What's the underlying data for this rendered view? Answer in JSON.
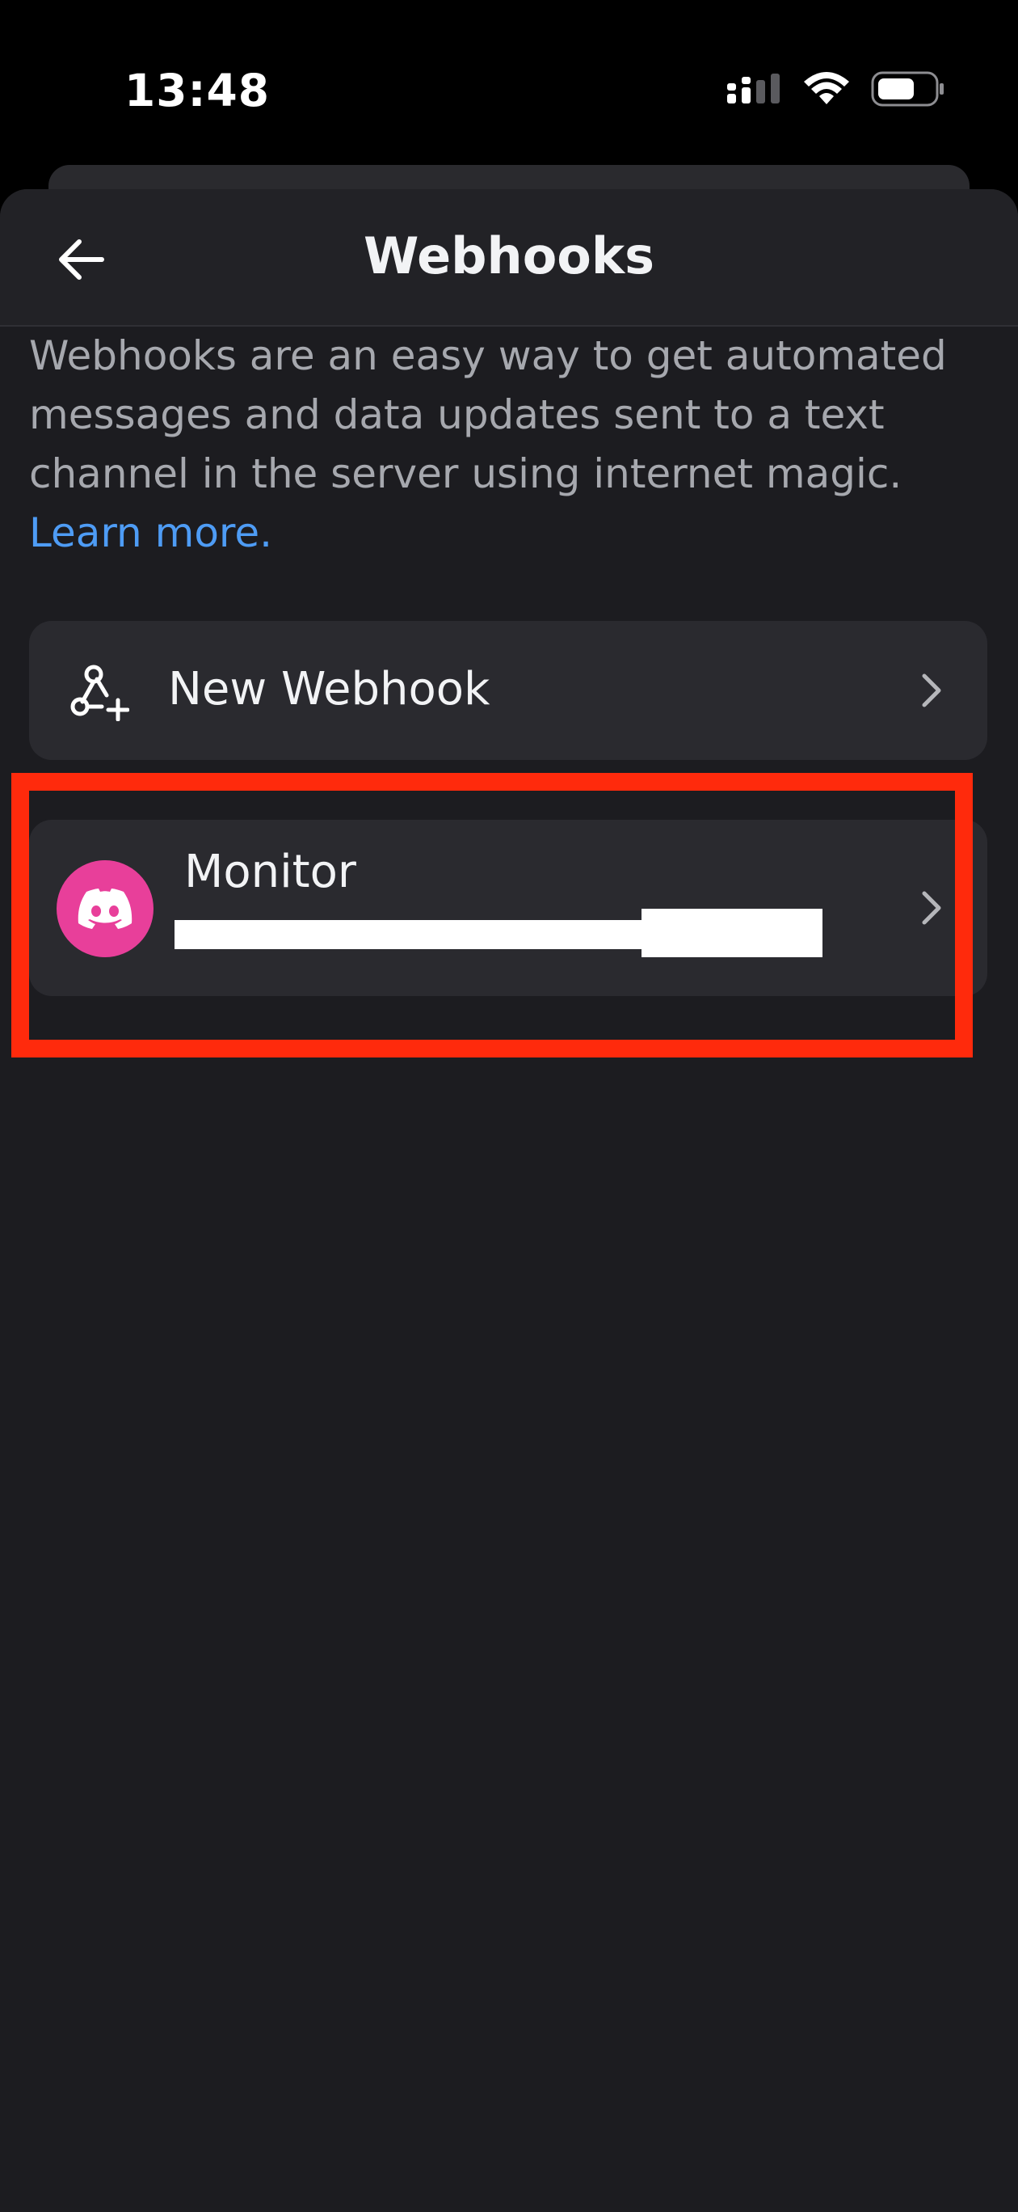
{
  "status_bar": {
    "time": "13:48",
    "icons": [
      "cellular-signal-icon",
      "wifi-icon",
      "battery-icon"
    ]
  },
  "header": {
    "title": "Webhooks",
    "back_icon": "arrow-left-icon"
  },
  "description": {
    "text": "Webhooks are an easy way to get automated messages and data updates sent to a text channel in the server using internet magic.",
    "link_text": "Learn more."
  },
  "new_webhook": {
    "label": "New Webhook",
    "icon": "webhook-add-icon"
  },
  "webhooks": [
    {
      "name": "Monitor",
      "avatar_icon": "discord-logo-icon",
      "avatar_color": "#e83f9a"
    }
  ],
  "colors": {
    "background": "#1c1c20",
    "row": "#2a2a2f",
    "link": "#4e9cf5",
    "highlight": "#ff2a0c"
  }
}
